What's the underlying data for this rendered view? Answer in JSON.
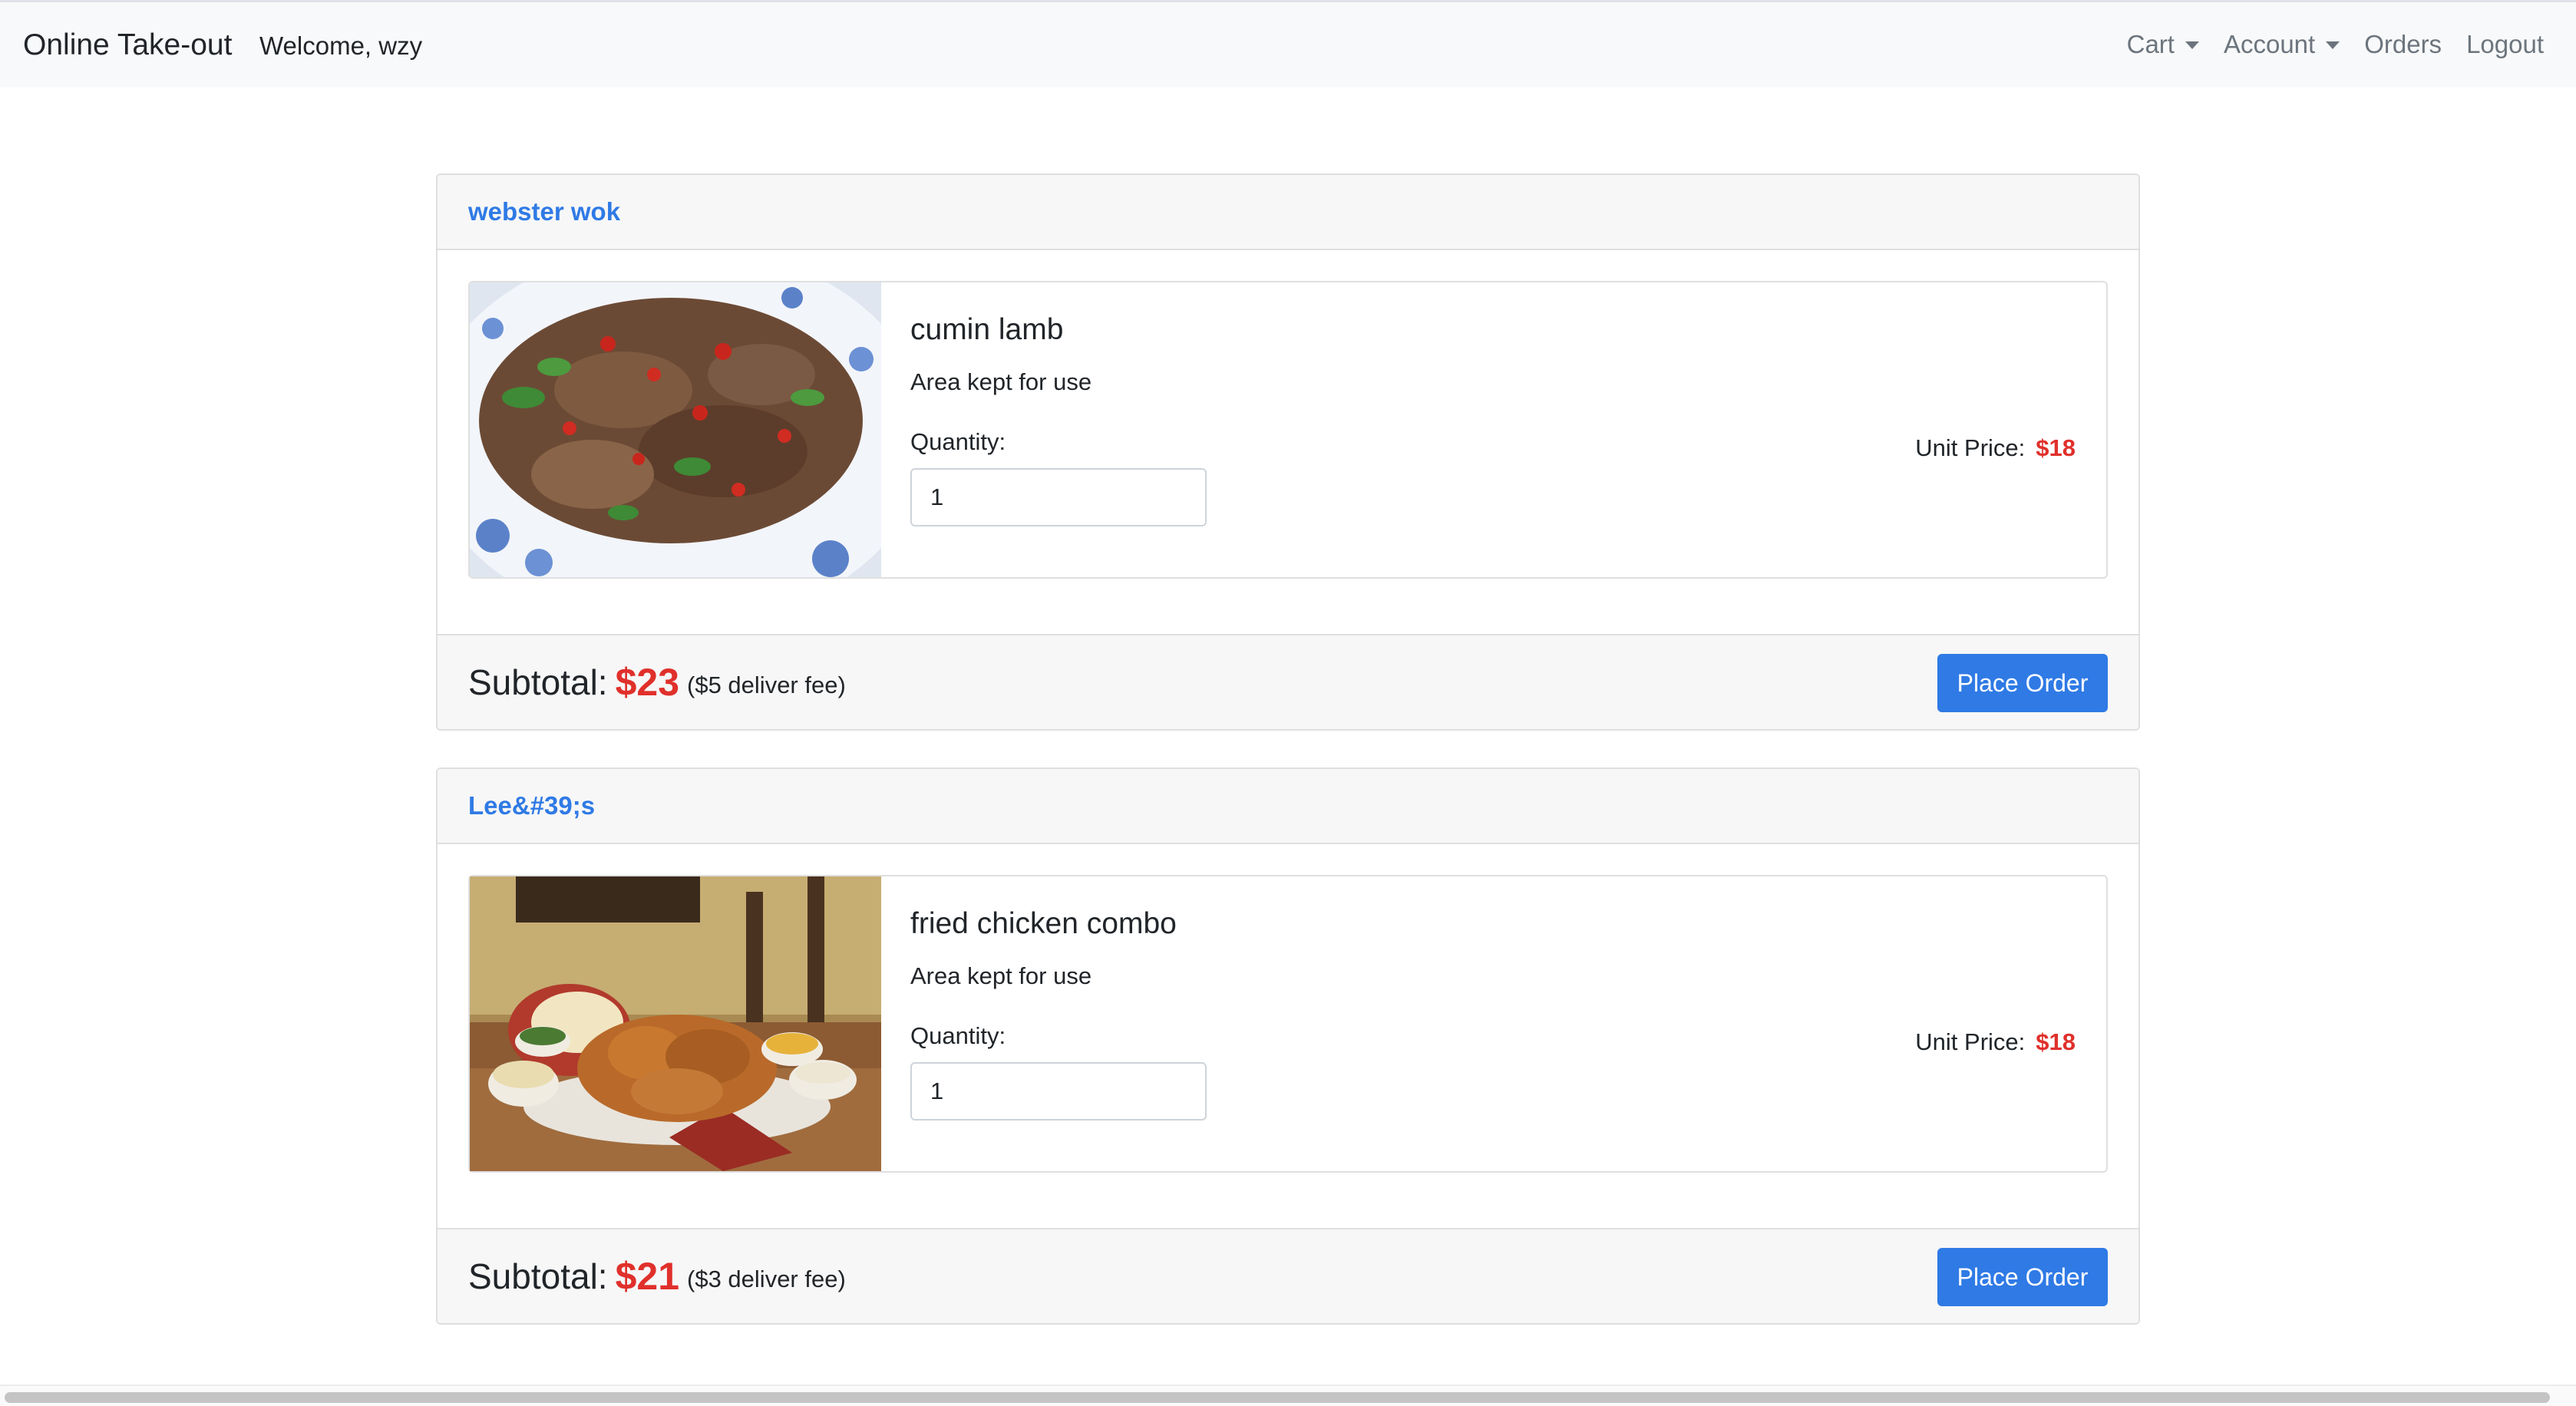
{
  "navbar": {
    "brand": "Online Take-out",
    "welcome": "Welcome, wzy",
    "links": {
      "cart": "Cart",
      "account": "Account",
      "orders": "Orders",
      "logout": "Logout"
    }
  },
  "orders": [
    {
      "restaurant": "webster wok",
      "item": {
        "name": "cumin lamb",
        "note": "Area kept for use",
        "quantity_label": "Quantity:",
        "quantity": "1",
        "unit_price_label": "Unit Price:",
        "unit_price": "$18",
        "image": "cumin-lamb-photo"
      },
      "subtotal_label": "Subtotal:",
      "subtotal": "$23",
      "fee": "($5 deliver fee)",
      "button": "Place Order"
    },
    {
      "restaurant": "Lee&#39;s",
      "item": {
        "name": "fried chicken combo",
        "note": "Area kept for use",
        "quantity_label": "Quantity:",
        "quantity": "1",
        "unit_price_label": "Unit Price:",
        "unit_price": "$18",
        "image": "fried-chicken-photo"
      },
      "subtotal_label": "Subtotal:",
      "subtotal": "$21",
      "fee": "($3 deliver fee)",
      "button": "Place Order"
    }
  ],
  "colors": {
    "accent": "#2f7ae5",
    "price": "#e0302b",
    "navbar_bg": "#f8f9fa"
  }
}
